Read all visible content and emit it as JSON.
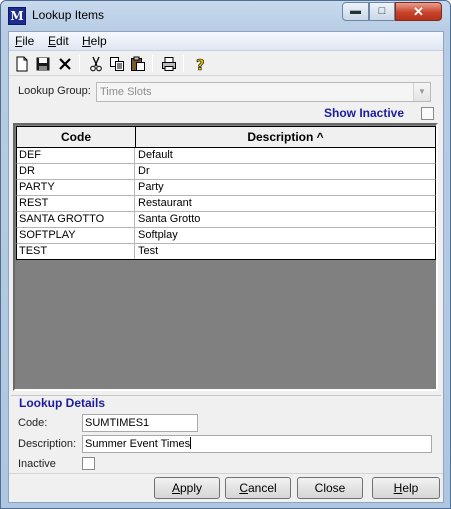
{
  "window": {
    "title": "Lookup Items",
    "app_icon_text": "M",
    "minimize_glyph": "▬",
    "maximize_glyph": "□",
    "close_glyph": "✕"
  },
  "menu": [
    {
      "label": "File",
      "accel": "F",
      "rest": "ile"
    },
    {
      "label": "Edit",
      "accel": "E",
      "rest": "dit"
    },
    {
      "label": "Help",
      "accel": "H",
      "rest": "elp"
    }
  ],
  "toolbar": {
    "icons": [
      "new-document-icon",
      "save-icon",
      "delete-icon",
      "cut-icon",
      "copy-icon",
      "paste-icon",
      "print-icon",
      "help-icon"
    ]
  },
  "lookup_group": {
    "label": "Lookup Group:",
    "value": "Time Slots",
    "arrow_glyph": "▼"
  },
  "show_inactive": {
    "label": "Show Inactive",
    "checked": false
  },
  "grid": {
    "columns": [
      {
        "label": "Code"
      },
      {
        "label": "Description ^"
      }
    ],
    "rows": [
      {
        "code": "DEF",
        "description": "Default"
      },
      {
        "code": "DR",
        "description": "Dr"
      },
      {
        "code": "PARTY",
        "description": "Party"
      },
      {
        "code": "REST",
        "description": "Restaurant"
      },
      {
        "code": "SANTA GROTTO",
        "description": "Santa Grotto"
      },
      {
        "code": "SOFTPLAY",
        "description": "Softplay"
      },
      {
        "code": "TEST",
        "description": "Test"
      }
    ]
  },
  "details": {
    "title": "Lookup Details",
    "code_label": "Code:",
    "code_value": "SUMTIMES1",
    "description_label": "Description:",
    "description_value": "Summer Event Times",
    "inactive_label": "Inactive",
    "inactive_checked": false
  },
  "buttons": {
    "apply": {
      "accel": "A",
      "rest": "pply"
    },
    "cancel": {
      "accel": "C",
      "rest": "ancel"
    },
    "close": {
      "accel": "",
      "rest": "Close"
    },
    "help": {
      "accel": "H",
      "rest": "elp"
    }
  },
  "colors": {
    "accent_text": "#1c1c9e",
    "grid_background": "#808080",
    "title_bar": "#b7cce4",
    "close_button": "#c7442b"
  }
}
